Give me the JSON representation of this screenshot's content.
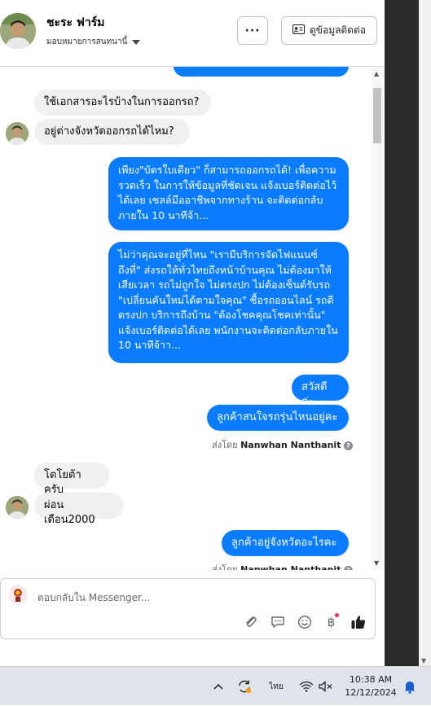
{
  "header": {
    "contact_name": "ชะระ ฟาร์ม",
    "assign_label": "มอบหมายการสนทนานี้",
    "more_label": "···",
    "contact_button_label": "ดูข้อมูลติดต่อ"
  },
  "messages": {
    "in_1": "ใช้เอกสารอะไรบ้างในการออกรถ?",
    "in_2": "อยู่ต่างจังหวัดออกรถได้ไหม?",
    "out_1": "เพียง\"บัตรใบเดียว\" ก็สามารถออกรถได้! เพื่อความรวดเร็ว ในการให้ข้อมูลที่ชัดเจน แจ้งเบอร์ติดต่อไว้ได้เลย เซลล์มืออาชีพจากทางร้าน จะติดต่อกลับภายใน 10 นาทีจ้า...",
    "out_2": "ไม่ว่าคุณจะอยู่ที่ไหน \"เรามีบริการจัดไฟแนนซ์ถึงที่\"  ส่งรถให้ทั่วไทยถึงหน้าบ้านคุณ ไม่ต้องมาให้เสียเวลา รถไม่ถูกใจ ไม่ตรงปก ไม่ต้องเซ็นต์รับรถ \"เปลี่ยนคันใหม่ได้ตามใจคุณ\" ซื้อรถออนไลน์ รถดี ตรงปก บริการถึงบ้าน \"ต้องโชคคุณโชคเท่านั้น\" แจ้งเบอร์ติดต่อได้เลย พนักงานจะติดต่อกลับภายใน 10 นาทีจ้าา...",
    "out_3": "สวัสดีค่ะ",
    "out_4": "ลูกค้าสนใจรถรุ่นไหนอยู่คะ",
    "sent_by_prefix": "ส่งโดย",
    "sent_by_name": "Nanwhan Nanthanit",
    "in_3": "โตโยต้าครับ",
    "in_4": "ผ่อนเดือน2000",
    "out_5": "ลูกค้าอยู่จังหวัดอะไรคะ"
  },
  "composer": {
    "placeholder": "ตอบกลับใน Messenger..."
  },
  "taskbar": {
    "language": "ไทย",
    "time": "10:38 AM",
    "date": "12/12/2024"
  },
  "colors": {
    "outgoing_bubble": "#0a7cff",
    "incoming_bubble": "#f0f0f0",
    "taskbar": "#dfe3ea"
  }
}
